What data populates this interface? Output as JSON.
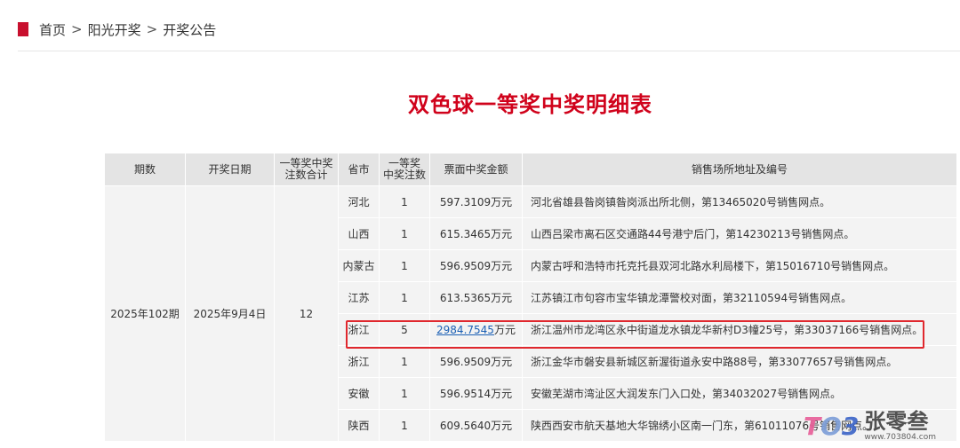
{
  "breadcrumb": {
    "items": [
      "首页",
      "阳光开奖",
      "开奖公告"
    ],
    "separator": ">"
  },
  "page_title": "双色球一等奖中奖明细表",
  "table": {
    "headers": {
      "period": "期数",
      "draw_date": "开奖日期",
      "total_count_line1": "一等奖中奖",
      "total_count_line2": "注数合计",
      "province": "省市",
      "count_line1": "一等奖",
      "count_line2": "中奖注数",
      "amount": "票面中奖金额",
      "address": "销售场所地址及编号"
    },
    "period": "2025年102期",
    "draw_date": "2025年9月4日",
    "total_count": "12",
    "rows": [
      {
        "province": "河北",
        "count": "1",
        "amount": "597.3109万元",
        "address": "河北省雄县昝岗镇昝岗派出所北侧，第13465020号销售网点。"
      },
      {
        "province": "山西",
        "count": "1",
        "amount": "615.3465万元",
        "address": "山西吕梁市离石区交通路44号港宁后门，第14230213号销售网点。"
      },
      {
        "province": "内蒙古",
        "count": "1",
        "amount": "596.9509万元",
        "address": "内蒙古呼和浩特市托克托县双河北路水利局楼下，第15016710号销售网点。"
      },
      {
        "province": "江苏",
        "count": "1",
        "amount": "613.5365万元",
        "address": "江苏镇江市句容市宝华镇龙潭警校对面，第32110594号销售网点。"
      },
      {
        "province": "浙江",
        "count": "5",
        "amount_link": "2984.7545",
        "amount_unit": "万元",
        "address": "浙江温州市龙湾区永中街道龙水镇龙华新村D3幢25号，第33037166号销售网点。"
      },
      {
        "province": "浙江",
        "count": "1",
        "amount": "596.9509万元",
        "address": "浙江金华市磐安县新城区新渥街道永安中路88号，第33077657号销售网点。"
      },
      {
        "province": "安徽",
        "count": "1",
        "amount": "596.9514万元",
        "address": "安徽芜湖市湾沚区大润发东门入口处，第34032027号销售网点。"
      },
      {
        "province": "陕西",
        "count": "1",
        "amount": "609.5640万元",
        "address": "陕西西安市航天基地大华锦绣小区南一门东，第61011076号销售网点。"
      }
    ]
  },
  "watermark": {
    "badge_t": "T",
    "badge_o": "O",
    "badge_n": "3",
    "name": "张零叁",
    "url": "www.703804.com"
  },
  "colors": {
    "accent_red": "#d0021b",
    "highlight_border": "#e0282e",
    "link_blue": "#1a5fb4",
    "header_bg": "#e4e4e4",
    "row_bg": "#f3f3f3"
  }
}
